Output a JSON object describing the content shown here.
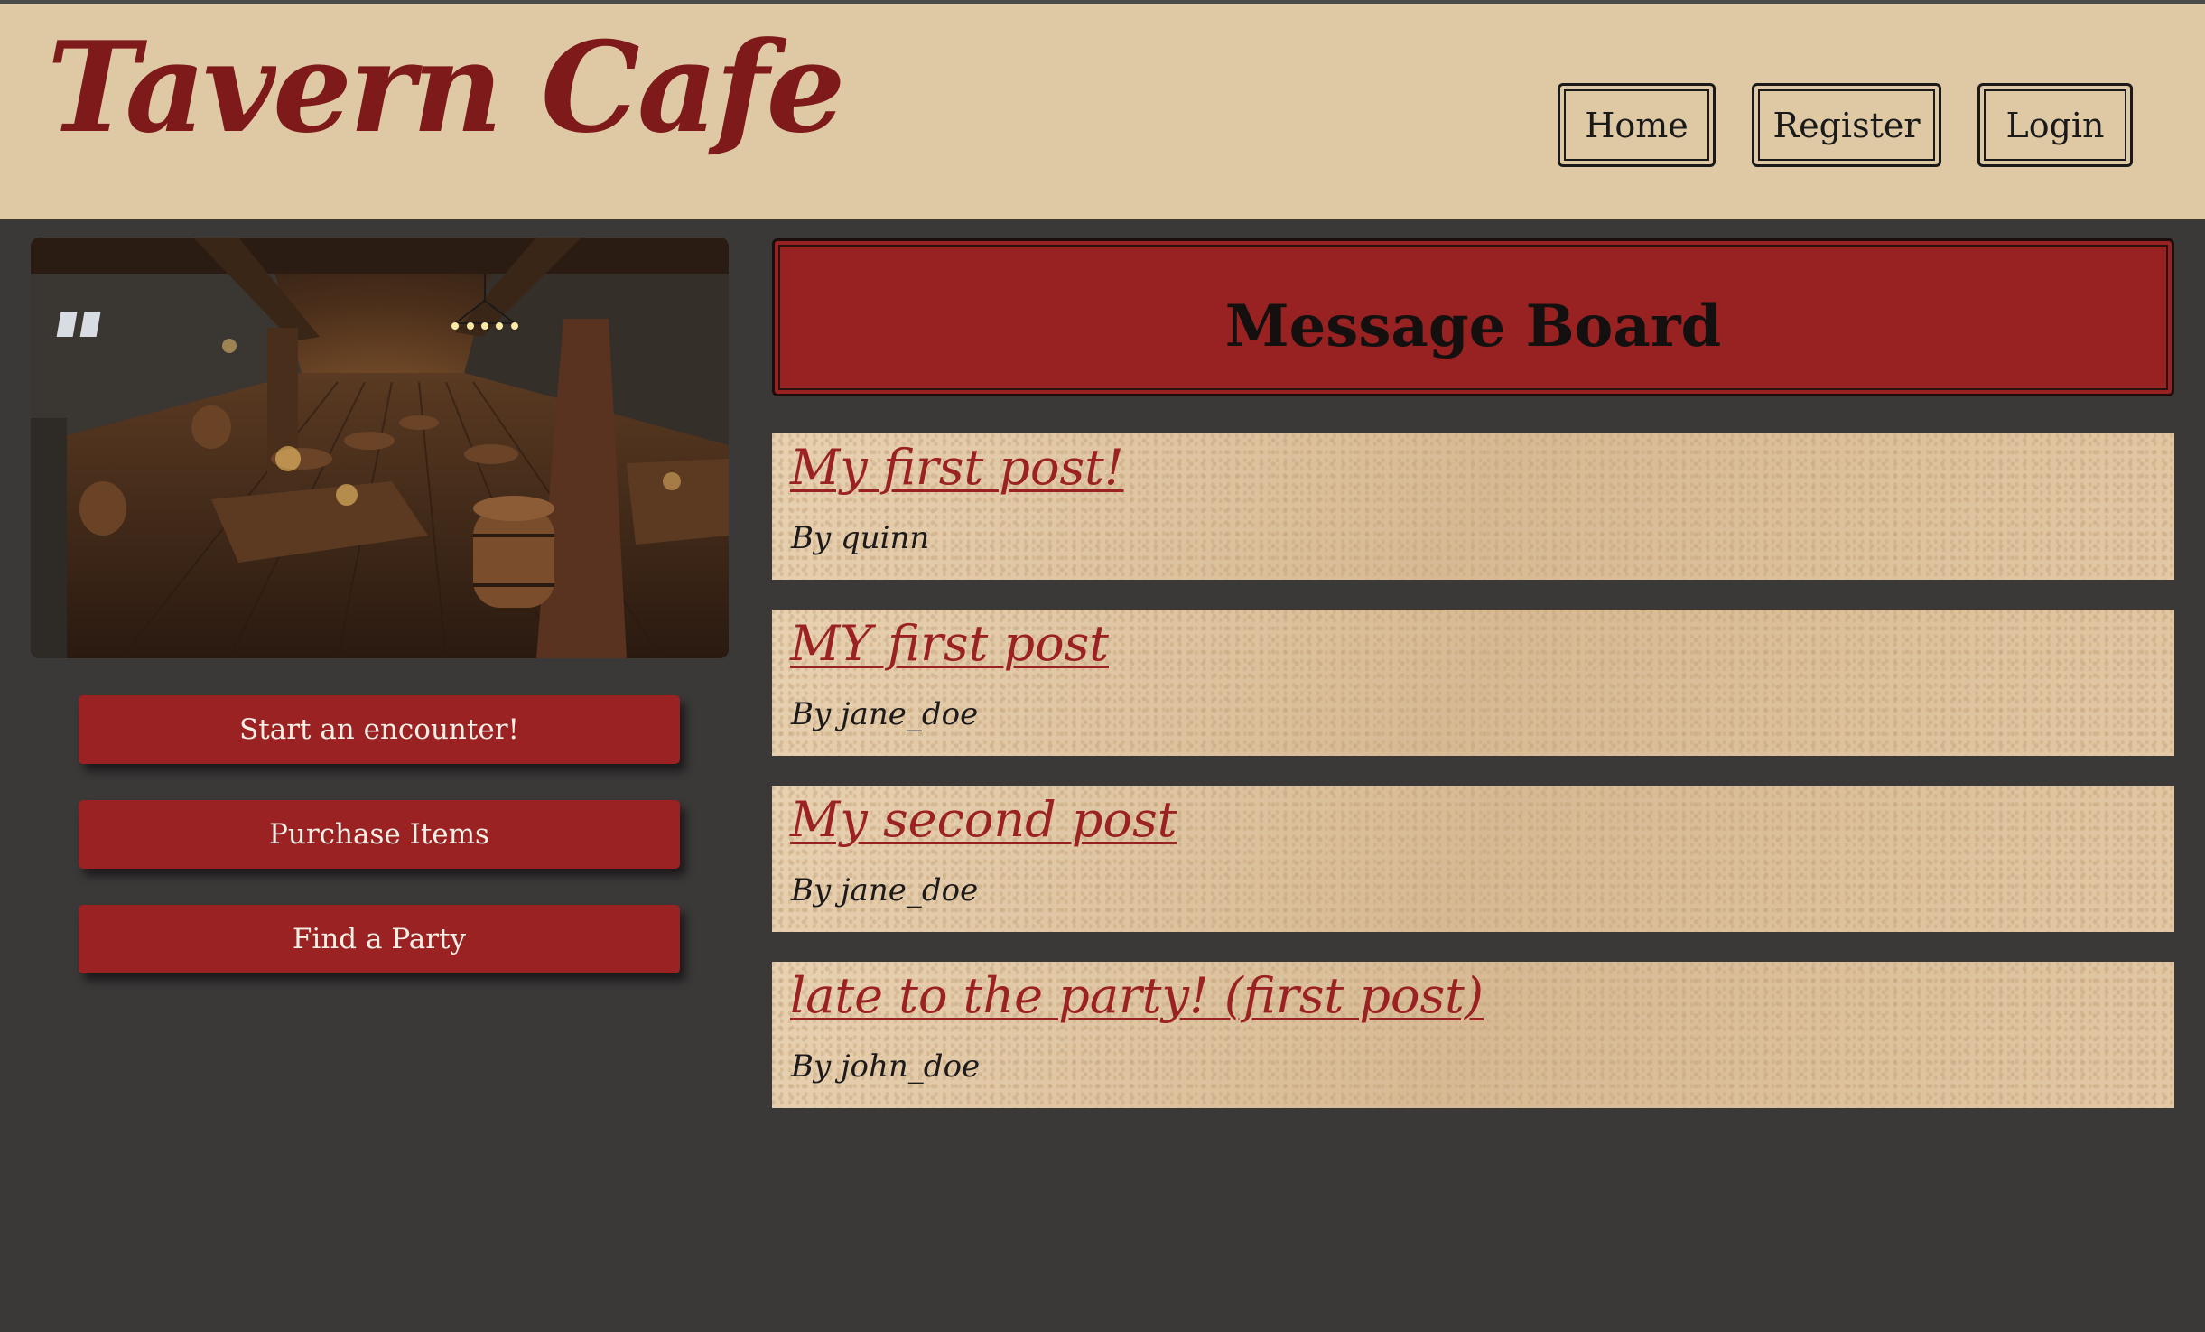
{
  "header": {
    "site_title": "Tavern Cafe",
    "nav": {
      "home": "Home",
      "register": "Register",
      "login": "Login"
    }
  },
  "sidebar": {
    "buttons": {
      "encounter": "Start an encounter!",
      "purchase": "Purchase Items",
      "party": "Find a Party"
    }
  },
  "board": {
    "title": "Message Board",
    "posts": [
      {
        "title": "My first post!",
        "author": "By quinn"
      },
      {
        "title": "MY first post",
        "author": "By jane_doe"
      },
      {
        "title": "My second post",
        "author": "By jane_doe"
      },
      {
        "title": "late to the party! (first post)",
        "author": "By john_doe"
      }
    ]
  },
  "colors": {
    "page_background": "#3b3838",
    "header_background": "#dec9a4",
    "accent_red": "#9a2222",
    "title_red": "#7e1a1a",
    "parchment": "#dcc19e"
  }
}
